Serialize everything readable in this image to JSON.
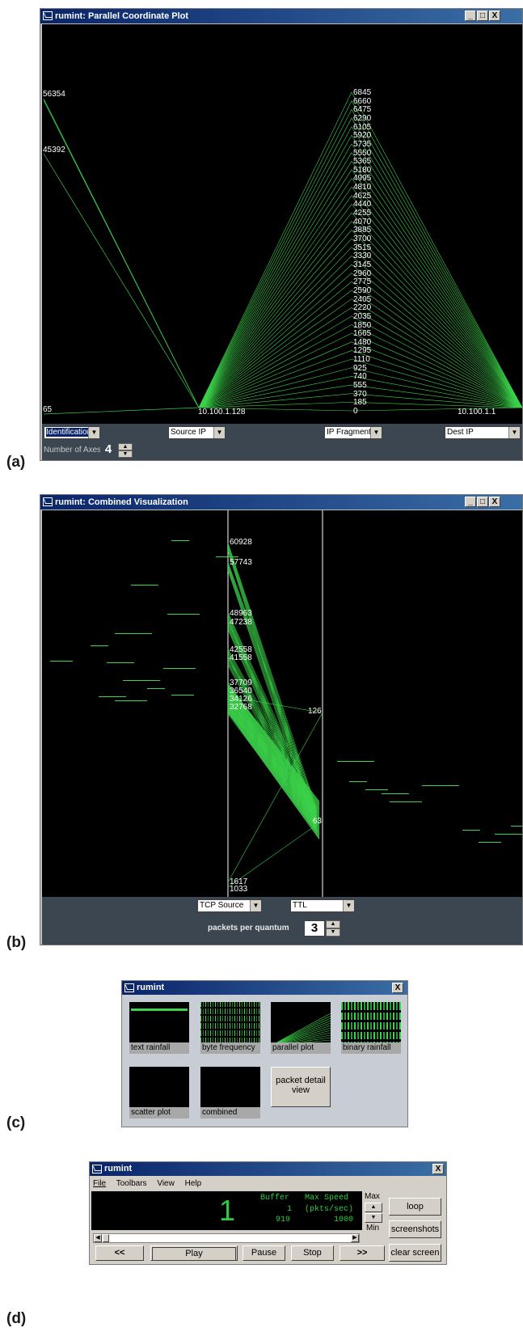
{
  "panels": {
    "a": "(a)",
    "b": "(b)",
    "c": "(c)",
    "d": "(d)"
  },
  "win_a": {
    "title": "rumint: Parallel Coordinate Plot",
    "title_buttons": [
      "_",
      "□",
      "X"
    ],
    "axis1_labels": [
      "56354",
      "45392",
      "65"
    ],
    "axis2_label": "10.100.1.128",
    "axis3_labels": [
      "6845",
      "6660",
      "6475",
      "6290",
      "6105",
      "5920",
      "5735",
      "5550",
      "5365",
      "5180",
      "4995",
      "4810",
      "4625",
      "4440",
      "4255",
      "4070",
      "3885",
      "3700",
      "3515",
      "3330",
      "3145",
      "2960",
      "2775",
      "2590",
      "2405",
      "2220",
      "2035",
      "1850",
      "1665",
      "1480",
      "1295",
      "1110",
      "925",
      "740",
      "555",
      "370",
      "185",
      "0"
    ],
    "axis4_label": "10.100.1.1",
    "dropdowns": [
      "Identification",
      "Source IP",
      "IP Fragment",
      "Dest IP"
    ],
    "num_axes_label": "Number of Axes",
    "num_axes_value": "4"
  },
  "win_b": {
    "title": "rumint: Combined Visualization",
    "title_buttons": [
      "_",
      "□",
      "X"
    ],
    "axis1_labels": [
      "60928",
      "57743",
      "48963",
      "47238",
      "42558",
      "41558",
      "37709",
      "36540",
      "34126",
      "32768",
      "1617",
      "1033"
    ],
    "axis2_labels": [
      "126",
      "63"
    ],
    "dropdowns": [
      "TCP Source",
      "TTL"
    ],
    "quantum_label": "packets per quantum",
    "quantum_value": "3"
  },
  "win_c": {
    "title": "rumint",
    "close": "X",
    "tiles": [
      "text rainfall",
      "byte frequency",
      "parallel plot",
      "binary rainfall",
      "scatter plot",
      "combined"
    ],
    "detail_button": "packet detail view"
  },
  "win_d": {
    "title": "rumint",
    "close": "X",
    "menu": [
      "File",
      "Toolbars",
      "View",
      "Help"
    ],
    "big_number": "1",
    "buffer_label": "Buffer",
    "buffer_value": "1",
    "buffer_total": "919",
    "max_speed_label": "Max Speed",
    "speed_units": "(pkts/sec)",
    "speed_value": "1000",
    "max_label": "Max",
    "min_label": "Min",
    "buttons": {
      "rewind": "<<",
      "play": "Play",
      "pause": "Pause",
      "stop": "Stop",
      "forward": ">>",
      "loop": "loop",
      "screenshots": "screenshots",
      "clear": "clear screen"
    }
  }
}
